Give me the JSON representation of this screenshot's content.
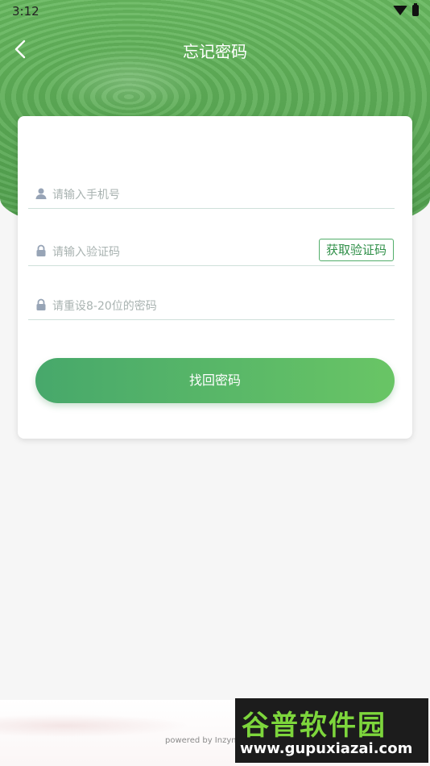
{
  "status_bar": {
    "time": "3:12"
  },
  "header": {
    "title": "忘记密码"
  },
  "form": {
    "phone_placeholder": "请输入手机号",
    "code_placeholder": "请输入验证码",
    "get_code_label": "获取验证码",
    "password_placeholder": "请重设8-20位的密码",
    "submit_label": "找回密码"
  },
  "footer": {
    "powered": "powered by Inzym..."
  },
  "watermark": {
    "title": "谷普软件园",
    "url": "www.gupuxiazai.com"
  },
  "colors": {
    "primary_green": "#52ae6a",
    "button_start": "#47a86b",
    "button_end": "#69c565"
  }
}
